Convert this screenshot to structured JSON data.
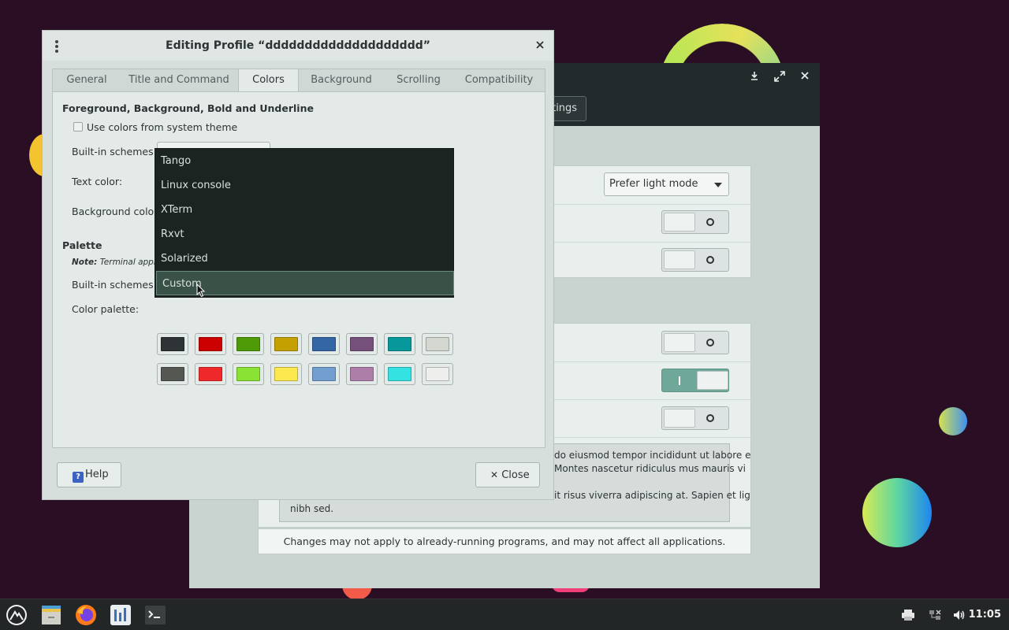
{
  "dialog": {
    "title": "Editing Profile “dddddddddddddddddddd”",
    "tabs": [
      "General",
      "Title and Command",
      "Colors",
      "Background",
      "Scrolling",
      "Compatibility"
    ],
    "active_tab": "Colors",
    "section_fg": "Foreground, Background, Bold and Underline",
    "use_system_colors": "Use colors from system theme",
    "builtin_schemes_label": "Built-in schemes:",
    "text_color_label": "Text color:",
    "background_color_label": "Background color:",
    "palette_header": "Palette",
    "palette_note_prefix": "Note:",
    "palette_note": "Terminal applic",
    "palette_schemes_label": "Built-in schemes:",
    "color_palette_label": "Color palette:",
    "help_label": "Help",
    "close_label": "Close",
    "palette": {
      "row1": [
        "#2e3436",
        "#cc0000",
        "#4e9a06",
        "#c4a000",
        "#3465a4",
        "#75507b",
        "#06989a",
        "#d3d7cf"
      ],
      "row2": [
        "#555753",
        "#ef2929",
        "#8ae234",
        "#fce94f",
        "#729fcf",
        "#ad7fa8",
        "#34e2e2",
        "#eeeeec"
      ]
    }
  },
  "popup": {
    "items": [
      "Tango",
      "Linux console",
      "XTerm",
      "Rxvt",
      "Solarized",
      "Custom"
    ],
    "selected": "Custom"
  },
  "settings_window": {
    "tab_fragment": "ttings",
    "appearance_dropdown": "Prefer light mode",
    "switches": [
      "off",
      "off",
      "off",
      "on",
      "off"
    ],
    "text_lines": [
      "do eiusmod tempor incididunt ut labore e",
      "Montes nascetur ridiculus mus mauris vi",
      "it risus viverra adipiscing at. Sapien et lig",
      "nibh sed."
    ],
    "footer_note": "Changes may not apply to already-running programs, and may not affect all applications."
  },
  "taskbar": {
    "clock": "11:05"
  }
}
